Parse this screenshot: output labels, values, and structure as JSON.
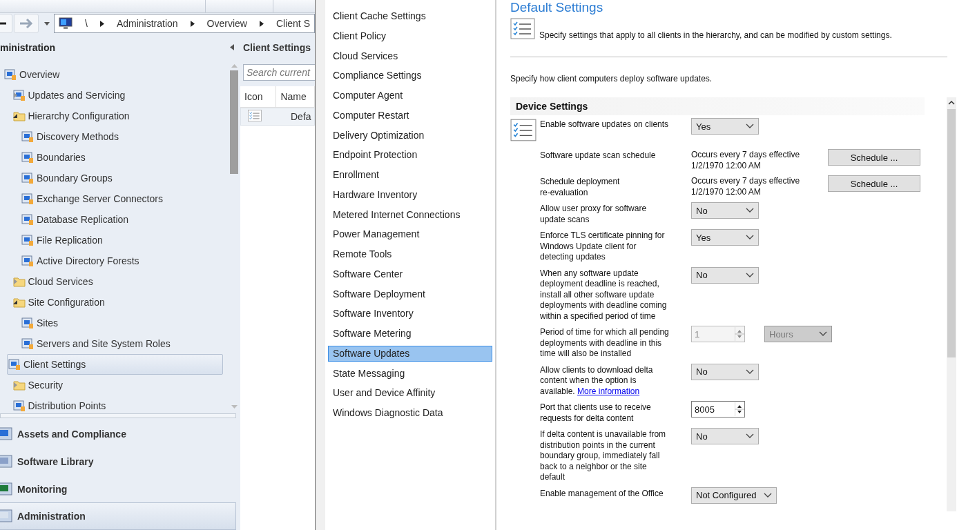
{
  "address_bar": {
    "breadcrumb": [
      "\\",
      "Administration",
      "Overview",
      "Client S"
    ]
  },
  "navigation": {
    "title": "ministration",
    "tree": [
      {
        "label": "Overview",
        "kind": "node",
        "selected": false,
        "children": [
          {
            "label": "Updates and Servicing",
            "kind": "node",
            "expanded": false,
            "selected": false
          },
          {
            "label": "Hierarchy Configuration",
            "kind": "folder",
            "expanded": true,
            "selected": false,
            "children": [
              {
                "label": "Discovery Methods",
                "kind": "node",
                "selected": false
              },
              {
                "label": "Boundaries",
                "kind": "node",
                "selected": false
              },
              {
                "label": "Boundary Groups",
                "kind": "node",
                "selected": false
              },
              {
                "label": "Exchange Server Connectors",
                "kind": "node",
                "selected": false
              },
              {
                "label": "Database Replication",
                "kind": "node",
                "selected": false
              },
              {
                "label": "File Replication",
                "kind": "node",
                "selected": false
              },
              {
                "label": "Active Directory Forests",
                "kind": "node",
                "selected": false
              }
            ]
          },
          {
            "label": "Cloud Services",
            "kind": "folder",
            "expanded": false,
            "selected": false
          },
          {
            "label": "Site Configuration",
            "kind": "folder",
            "expanded": true,
            "selected": false,
            "children": [
              {
                "label": "Sites",
                "kind": "node",
                "selected": false
              },
              {
                "label": "Servers and Site System Roles",
                "kind": "node",
                "selected": false
              }
            ]
          },
          {
            "label": "Client Settings",
            "kind": "node",
            "selected": true
          },
          {
            "label": "Security",
            "kind": "folder",
            "expanded": false,
            "selected": false
          },
          {
            "label": "Distribution Points",
            "kind": "node",
            "selected": false
          }
        ]
      }
    ],
    "sections": [
      {
        "label": "Assets and Compliance",
        "selected": false
      },
      {
        "label": "Software Library",
        "selected": false
      },
      {
        "label": "Monitoring",
        "selected": false
      },
      {
        "label": "Administration",
        "selected": true
      }
    ]
  },
  "list_pane": {
    "title": "Client Settings",
    "search": {
      "placeholder": "Search current"
    },
    "columns": [
      "Icon",
      "Name"
    ],
    "rows": [
      {
        "name": "Defa"
      }
    ]
  },
  "dialog": {
    "categories": [
      {
        "label": "Client Cache Settings",
        "selected": false
      },
      {
        "label": "Client Policy",
        "selected": false
      },
      {
        "label": "Cloud Services",
        "selected": false
      },
      {
        "label": "Compliance Settings",
        "selected": false
      },
      {
        "label": "Computer Agent",
        "selected": false
      },
      {
        "label": "Computer Restart",
        "selected": false
      },
      {
        "label": "Delivery Optimization",
        "selected": false
      },
      {
        "label": "Endpoint Protection",
        "selected": false
      },
      {
        "label": "Enrollment",
        "selected": false
      },
      {
        "label": "Hardware Inventory",
        "selected": false
      },
      {
        "label": "Metered Internet Connections",
        "selected": false
      },
      {
        "label": "Power Management",
        "selected": false
      },
      {
        "label": "Remote Tools",
        "selected": false
      },
      {
        "label": "Software Center",
        "selected": false
      },
      {
        "label": "Software Deployment",
        "selected": false
      },
      {
        "label": "Software Inventory",
        "selected": false
      },
      {
        "label": "Software Metering",
        "selected": false
      },
      {
        "label": "Software Updates",
        "selected": true
      },
      {
        "label": "State Messaging",
        "selected": false
      },
      {
        "label": "User and Device Affinity",
        "selected": false
      },
      {
        "label": "Windows Diagnostic Data",
        "selected": false
      }
    ],
    "title": "Default Settings",
    "description": "Specify settings that apply to all clients in the hierarchy, and can be modified by custom settings.",
    "intro": "Specify how client computers deploy software updates.",
    "group": {
      "title": "Device Settings",
      "settings": [
        {
          "kind": "dropdown",
          "label": "Enable software updates on clients",
          "value": "Yes",
          "disabled": false
        },
        {
          "kind": "schedule",
          "label": "Software update scan schedule",
          "value": "Occurs every 7 days effective\n1/2/1970 12:00 AM",
          "button": "Schedule ..."
        },
        {
          "kind": "schedule",
          "label": "Schedule deployment\nre-evaluation",
          "value": "Occurs every 7 days effective\n1/2/1970 12:00 AM",
          "button": "Schedule ..."
        },
        {
          "kind": "dropdown",
          "label": "Allow user proxy for software\nupdate scans",
          "value": "No",
          "disabled": false
        },
        {
          "kind": "dropdown",
          "label": "Enforce TLS certificate pinning for\nWindows Update client for\ndetecting updates",
          "value": "Yes",
          "disabled": false
        },
        {
          "kind": "dropdown",
          "label": "When any software update\ndeployment deadline is reached,\ninstall all other software update\ndeployments with deadline coming\nwithin a specified period of time",
          "value": "No",
          "disabled": false
        },
        {
          "kind": "period",
          "label": "Period of time for which all pending\ndeployments with deadline in this\ntime will also be installed",
          "value": "1",
          "unit": "Hours",
          "disabled": true
        },
        {
          "kind": "dropdown",
          "label": "Allow clients to download delta\ncontent when the option is\navailable.",
          "link": "More information",
          "value": "No",
          "disabled": false
        },
        {
          "kind": "spinner",
          "label": "Port that clients use to receive\nrequests for delta content",
          "value": "8005",
          "disabled": false
        },
        {
          "kind": "dropdown",
          "label": "If delta content is unavailable from\ndistribution points in the current\nboundary group, immediately fall\nback to a neighbor or the site\ndefault",
          "value": "No",
          "disabled": false
        },
        {
          "kind": "dropdown",
          "label": "Enable management of the Office",
          "value": "Not Configured",
          "disabled": false,
          "wide": true
        }
      ]
    }
  }
}
